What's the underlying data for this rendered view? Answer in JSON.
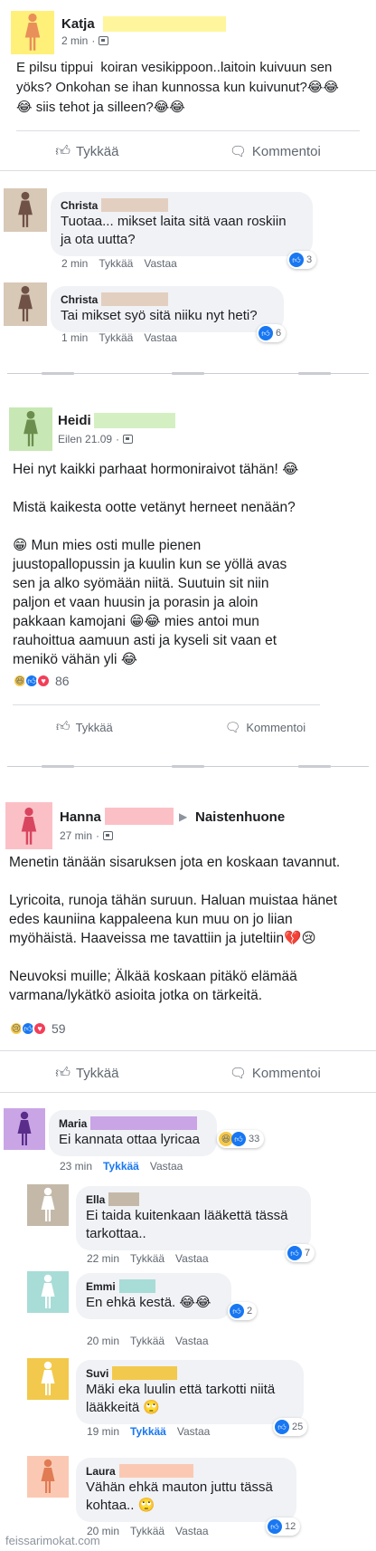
{
  "colors": {
    "accent_blue": "#1877f2",
    "katja_avatar": "#fff07a",
    "katja_name_highlight": "#fff59d",
    "christa_avatar": "#d8c8b6",
    "christa_name_highlight": "#e3cfc0",
    "heidi_avatar": "#c7e8b4",
    "heidi_name_highlight": "#d4f0c2",
    "hanna_avatar": "#fbc0c6",
    "hanna_name_highlight": "#fbc0c6",
    "maria_avatar": "#c9a5e6",
    "maria_name_highlight": "#c9a5e6",
    "ella_avatar": "#c4b9a8",
    "ella_name_highlight": "#c4b9a8",
    "emmi_avatar": "#a8dcd7",
    "emmi_name_highlight": "#a8dcd7",
    "suvi_avatar": "#f2c94c",
    "suvi_name_highlight": "#f2c94c",
    "laura_avatar": "#fbc9b3",
    "laura_name_highlight": "#fbc9b3"
  },
  "post1": {
    "author": "Katja",
    "time": "2 min",
    "text": "E pilsu tippui  koiran vesikippoon..laitoin kuivuun sen yöks? Onkohan se ihan kunnossa kun kuivunut?😂😂\n😂 siis tehot ja silleen?😂😂",
    "like_label": "Tykkää",
    "comment_label": "Kommentoi",
    "comments": [
      {
        "name": "Christa",
        "text": "Tuotaa... mikset laita sitä vaan roskiin\nja ota uutta?",
        "time": "2 min",
        "like": "Tykkää",
        "reply": "Vastaa",
        "reactions": "3"
      },
      {
        "name": "Christa",
        "text": "Tai mikset syö sitä niiku nyt heti?",
        "time": "1 min",
        "like": "Tykkää",
        "reply": "Vastaa",
        "reactions": "6"
      }
    ]
  },
  "post2": {
    "author": "Heidi",
    "time": "Eilen 21.09",
    "text": "Hei nyt kaikki parhaat hormoniraivot tähän! 😂\n\nMistä kaikesta ootte vetänyt herneet nenään?\n\n😁 Mun mies osti mulle pienen\njuustopallopussin ja kuulin kun se yöllä avas\nsen ja alko syömään niitä. Suutuin sit niin\npaljon et vaan huusin ja porasin ja aloin\npakkaan kamojani 😁😂 mies antoi mun\nrauhoittua aamuun asti ja kyseli sit vaan et\nmenikö vähän yli 😂",
    "reaction_count": "86",
    "like_label": "Tykkää",
    "comment_label": "Kommentoi"
  },
  "post3": {
    "author": "Hanna",
    "group": "Naistenhuone",
    "time": "27 min",
    "text": "Menetin tänään sisaruksen jota en koskaan tavannut.\n\nLyricoita, runoja tähän suruun. Haluan muistaa hänet\nedes kauniina kappaleena kun muu on jo liian\nmyöhäistä. Haaveissa me tavattiin ja juteltiin💔😢\n\nNeuvoksi muille; Älkää koskaan pitäkö elämää\nvarmana/lykätkö asioita jotka on tärkeitä.",
    "reaction_count": "59",
    "like_label": "Tykkää",
    "comment_label": "Kommentoi",
    "comments": [
      {
        "name": "Maria",
        "text": "Ei kannata ottaa lyricaa",
        "time": "23 min",
        "like": "Tykkää",
        "reply": "Vastaa",
        "reactions": "33",
        "liked": true
      },
      {
        "name": "Ella",
        "text": "Ei taida kuitenkaan lääkettä tässä\ntarkottaa..",
        "time": "22 min",
        "like": "Tykkää",
        "reply": "Vastaa",
        "reactions": "7"
      },
      {
        "name": "Emmi",
        "text": "En ehkä kestä. 😂😂",
        "time": "20 min",
        "like": "Tykkää",
        "reply": "Vastaa",
        "reactions": "2"
      },
      {
        "name": "Suvi",
        "text": "Mäki eka luulin että tarkotti niitä\nlääkkeitä 🙄",
        "time": "19 min",
        "like": "Tykkää",
        "reply": "Vastaa",
        "reactions": "25",
        "liked": true
      },
      {
        "name": "Laura",
        "text": "Vähän ehkä mauton juttu tässä\nkohtaa.. 🙄",
        "time": "20 min",
        "like": "Tykkää",
        "reply": "Vastaa",
        "reactions": "12"
      }
    ]
  },
  "watermark": "feissarimokat.com"
}
